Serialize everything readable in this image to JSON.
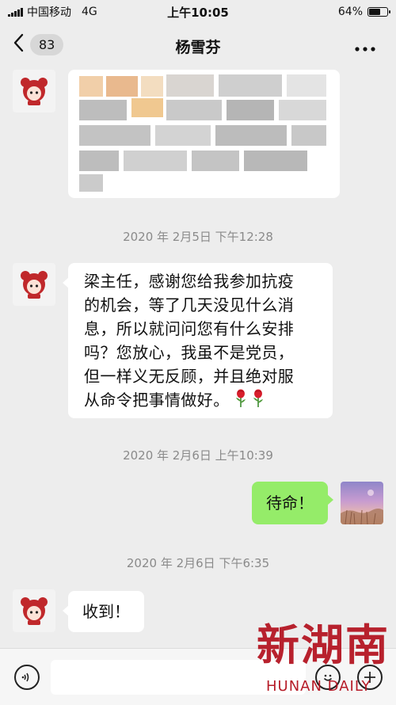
{
  "status_bar": {
    "carrier": "中国移动",
    "network": "4G",
    "time": "上午10:05",
    "battery": "64%",
    "battery_level": 0.64
  },
  "nav": {
    "unread_count": "83",
    "title": "杨雪芬"
  },
  "messages": [
    {
      "timestamp": "2020 年 2月5日 下午12:28",
      "text_lines": [
        "梁主任，感谢您给我参加抗疫",
        "的机会，等了几天没见什么消",
        "息，所以就问问您有什么安排",
        "吗？您放心，我虽不是党员，",
        "但一样义无反顾，并且绝对服",
        "从命令把事情做好。"
      ],
      "emoji": [
        "rose",
        "rose"
      ]
    },
    {
      "timestamp": "2020 年 2月6日 上午10:39",
      "text": "待命！"
    },
    {
      "timestamp": "2020 年 2月6日 下午6:35",
      "text": "收到！"
    }
  ],
  "watermark": {
    "chinese": "新湖南",
    "english": "HUNAN DAILY"
  },
  "colors": {
    "background": "#ededed",
    "outgoing_bubble": "#95ec69",
    "incoming_bubble": "#ffffff",
    "watermark": "#b3101d"
  },
  "icons": [
    "chevron-left-icon",
    "more-icon",
    "avatar-bear-icon",
    "rose-icon",
    "voice-icon",
    "emoji-icon",
    "plus-icon"
  ]
}
